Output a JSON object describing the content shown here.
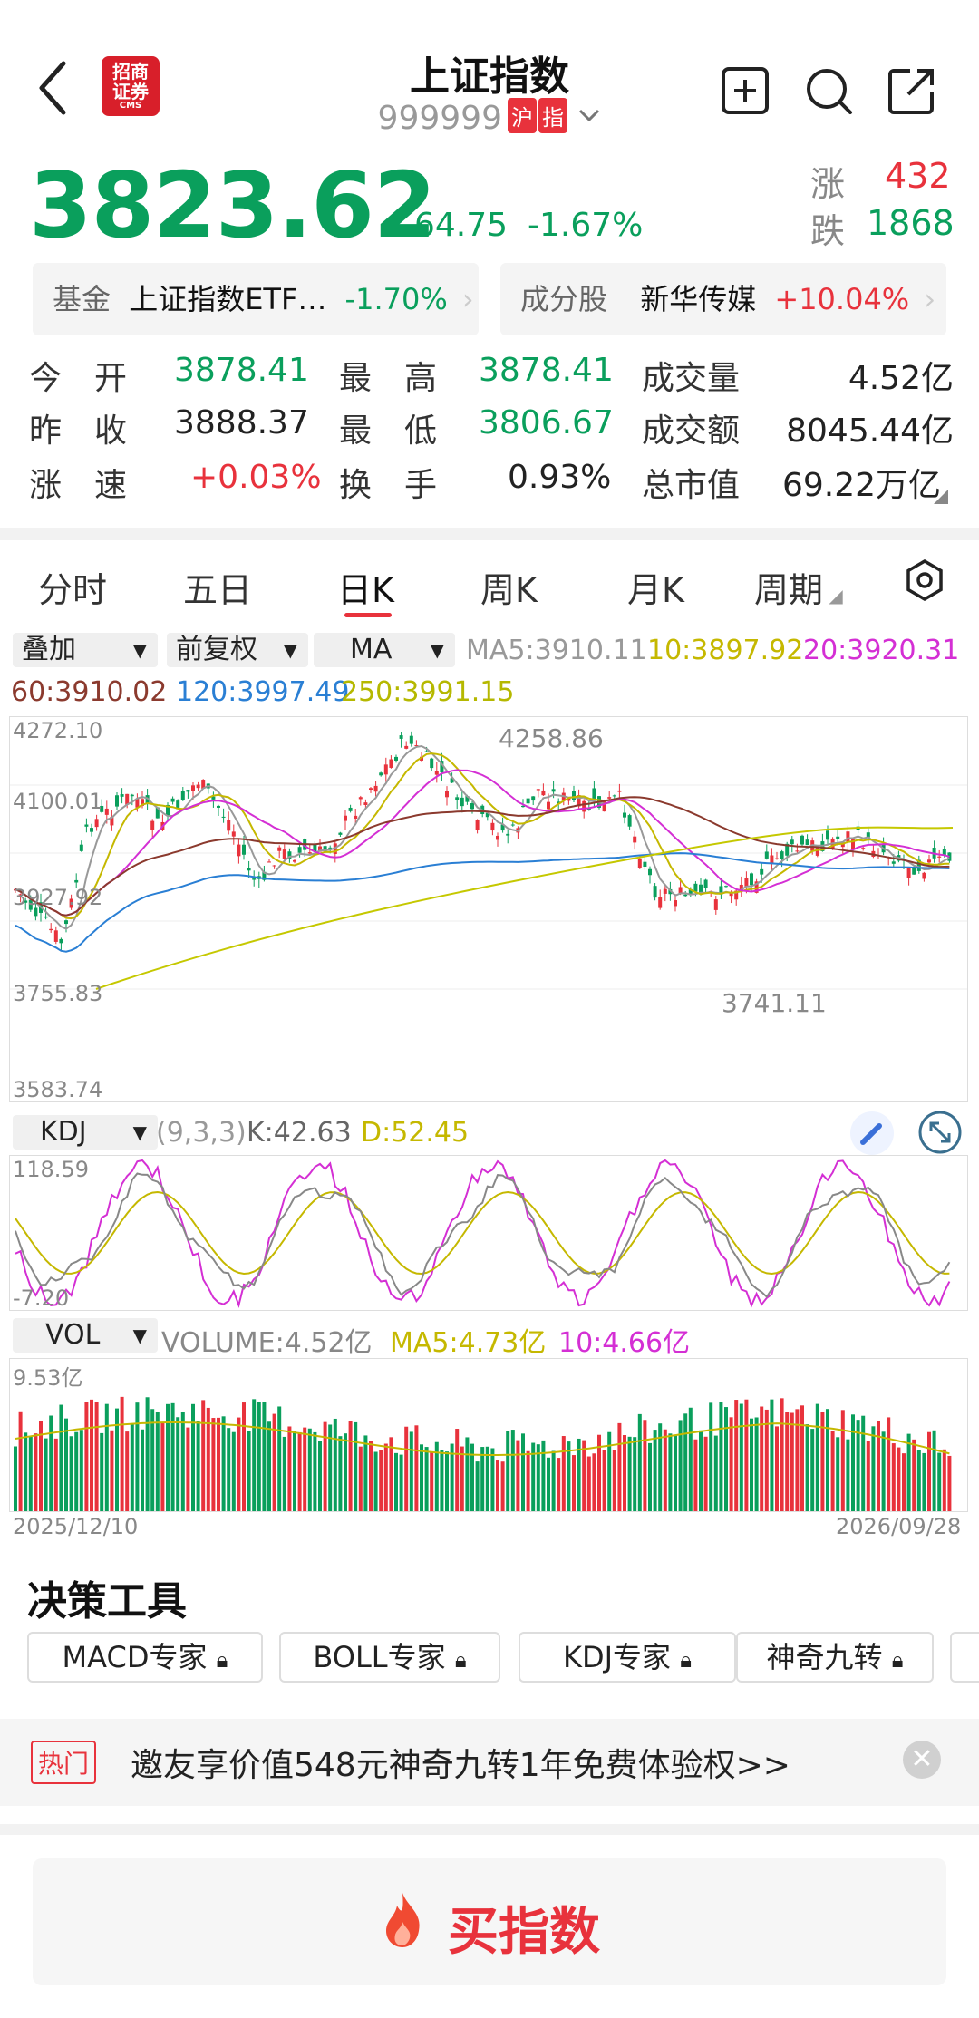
{
  "header": {
    "title": "上证指数",
    "code": "999999",
    "market_tag": "沪",
    "index_tag": "指",
    "logo_text_1": "招商",
    "logo_text_2": "证券",
    "logo_text_3": "CMS"
  },
  "quote": {
    "price": "3823.62",
    "change": "-64.75",
    "change_pct": "-1.67%",
    "up_label": "涨",
    "up_count": "432",
    "down_label": "跌",
    "down_count": "1868"
  },
  "fund": {
    "label": "基金",
    "name": "上证指数ETF…",
    "pct": "-1.70%"
  },
  "component": {
    "label": "成分股",
    "name": "新华传媒",
    "pct": "+10.04%"
  },
  "stats": [
    [
      {
        "label": "今　开",
        "value": "3878.41"
      },
      {
        "label": "最　高",
        "value": "3878.41"
      },
      {
        "label": "成交量",
        "value": "4.52亿"
      }
    ],
    [
      {
        "label": "昨　收",
        "value": "3888.37"
      },
      {
        "label": "最　低",
        "value": "3806.67"
      },
      {
        "label": "成交额",
        "value": "8045.44亿"
      }
    ],
    [
      {
        "label": "涨　速",
        "value": "+0.03%"
      },
      {
        "label": "换　手",
        "value": "0.93%"
      },
      {
        "label": "总市值",
        "value": "69.22万亿"
      }
    ]
  ],
  "tabs": [
    "分时",
    "五日",
    "日K",
    "周K",
    "月K",
    "周期"
  ],
  "selectors": {
    "overlay": "叠加",
    "adjust": "前复权",
    "ma": "MA"
  },
  "ma": {
    "ma5": "MA5:3910.11",
    "ma10": "10:3897.92",
    "ma20": "20:3920.31",
    "ma60": "60:3910.02",
    "ma120": "120:3997.49",
    "ma250": "250:3991.15"
  },
  "price_axis": {
    "top": "4272.10",
    "l2": "4100.01",
    "l3": "3927.92",
    "l4": "3755.83",
    "bottom": "3583.74",
    "high_mark": "4258.86",
    "low_mark": "3741.11"
  },
  "kdj": {
    "name": "KDJ",
    "params": "(9,3,3)",
    "k": "K:42.63",
    "d": "D:52.45",
    "top": "118.59",
    "bottom": "-7.20"
  },
  "vol": {
    "name": "VOL",
    "volume": "VOLUME:4.52亿",
    "ma5": "MA5:4.73亿",
    "ma10": "10:4.66亿",
    "top": "9.53亿",
    "start_date": "2025/12/10",
    "end_date": "2026/09/28"
  },
  "tools": {
    "title": "决策工具",
    "items": [
      "MACD专家",
      "BOLL专家",
      "KDJ专家",
      "神奇九转"
    ]
  },
  "banner": {
    "tag": "热门",
    "text": "邀友享价值548元神奇九转1年免费体验权>>"
  },
  "buy": {
    "label": "买指数"
  },
  "colors": {
    "red": "#e8323c",
    "green": "#0a9f5c",
    "ma5": "#999999",
    "ma10": "#c5b800",
    "ma20": "#d42fd4",
    "ma60": "#8b3a2e",
    "ma120": "#2a7fd4",
    "ma250": "#c5c800"
  },
  "chart_data": [
    {
      "type": "candlestick",
      "ylim": [
        3583.74,
        4272.1
      ],
      "high": 4258.86,
      "low": 3741.11,
      "x_range": [
        "2025/12/10",
        "2026/09/28"
      ]
    },
    {
      "type": "line",
      "name": "KDJ",
      "ylim": [
        -7.2,
        118.59
      ]
    },
    {
      "type": "bar",
      "name": "VOL",
      "ylim": [
        0,
        9.53
      ]
    }
  ]
}
